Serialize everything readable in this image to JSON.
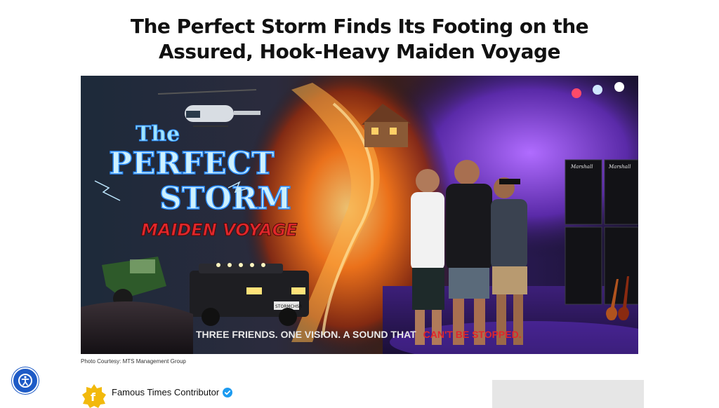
{
  "article": {
    "headline": "The Perfect Storm Finds Its Footing on the Assured, Hook-Heavy Maiden Voyage",
    "photo_caption": "Photo Courtesy: MTS Management Group"
  },
  "hero_image": {
    "title_line1": "The",
    "title_line2": "PERFECT",
    "title_line3": "STORM",
    "subtitle": "MAIDEN VOYAGE",
    "tagline_main": "THREE FRIENDS. ONE VISION. A SOUND THAT",
    "tagline_accent": "CAN'T BE STOPPED.",
    "plate": "STORMCHSR",
    "amp_brand": "Marshall"
  },
  "author": {
    "name": "Famous Times Contributor",
    "logo_icon": "famous-times-logo",
    "verified_icon": "verified-check-icon"
  },
  "accessibility": {
    "icon": "accessibility-icon"
  },
  "colors": {
    "accessibility_blue": "#1e5bc6",
    "verified_blue": "#1d9bf0",
    "logo_gold": "#f2b90c",
    "tagline_red": "#e0272b",
    "title_glow": "#7fd4ff"
  }
}
